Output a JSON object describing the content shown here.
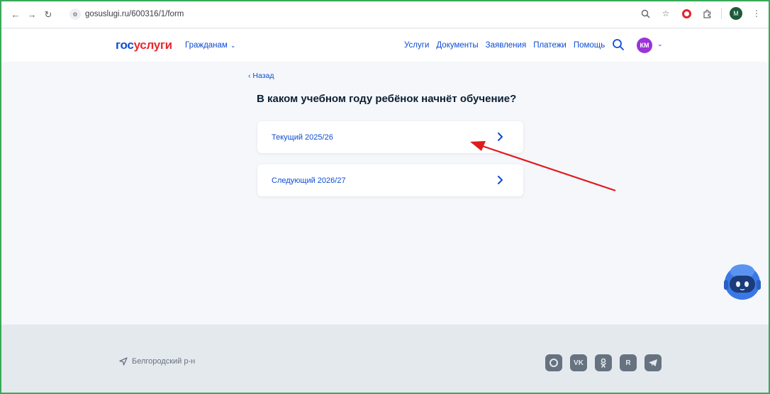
{
  "browser": {
    "url": "gosuslugi.ru/600316/1/form",
    "profile_initial": "M"
  },
  "header": {
    "logo_part1": "гос",
    "logo_part2": "услуги",
    "citizens_label": "Гражданам",
    "nav": [
      "Услуги",
      "Документы",
      "Заявления",
      "Платежи",
      "Помощь"
    ],
    "avatar_initials": "КМ"
  },
  "content": {
    "back_label": "‹ Назад",
    "question": "В каком учебном году ребёнок начнёт обучение?",
    "options": [
      {
        "label": "Текущий 2025/26"
      },
      {
        "label": "Следующий 2026/27"
      }
    ]
  },
  "footer": {
    "region": "Белгородский р-н",
    "socials": [
      "max-icon",
      "vk-icon",
      "ok-icon",
      "rutube-icon",
      "telegram-icon"
    ]
  },
  "colors": {
    "accent": "#0d4cd3",
    "logo_red": "#e8292f",
    "annotation_arrow": "#e01b1b",
    "frame_border": "#3aa95a"
  }
}
